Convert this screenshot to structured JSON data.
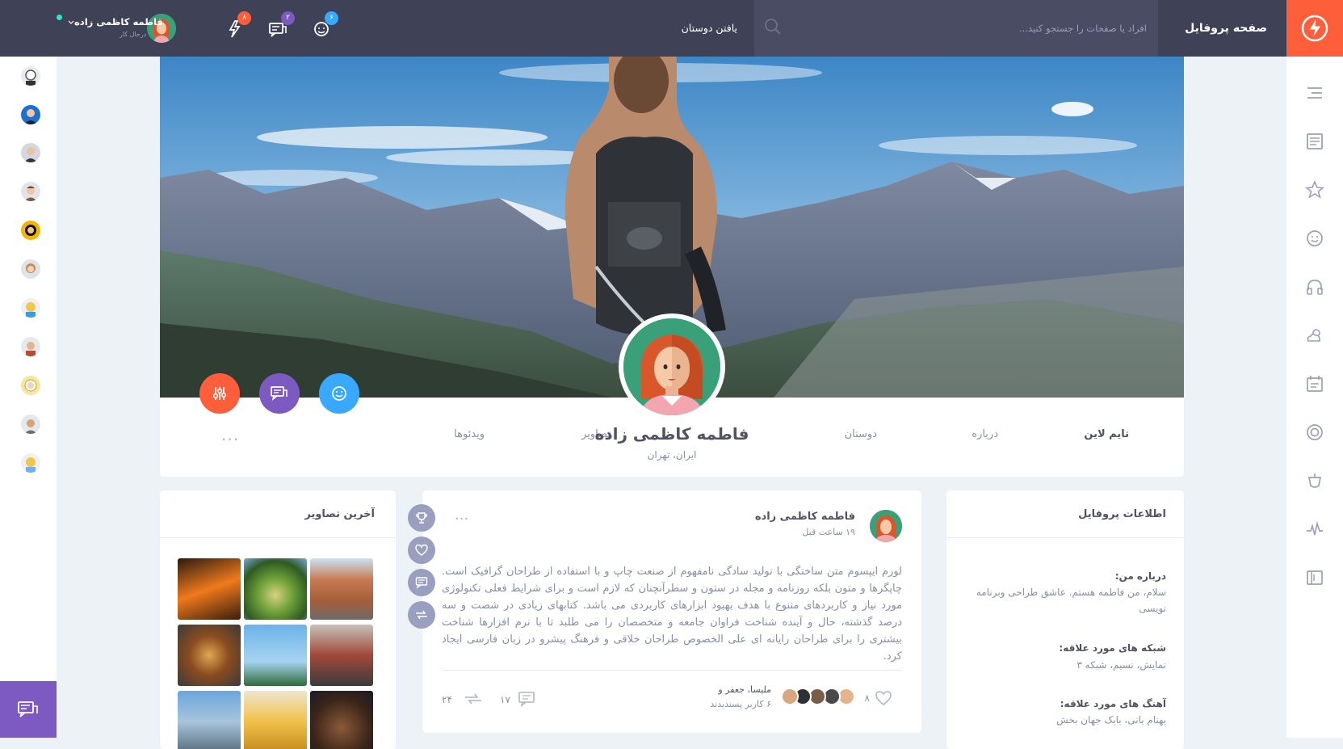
{
  "header": {
    "page_title": "صفحه پروفایل",
    "search_placeholder": "افراد یا صفحات را جستجو کنید...",
    "find_friends": "یافتن دوستان",
    "notifications": [
      {
        "icon": "friend-request-icon",
        "count": "۶",
        "color": "#38a9ff"
      },
      {
        "icon": "messages-icon",
        "count": "۲",
        "color": "#7c5ac2"
      },
      {
        "icon": "activity-icon",
        "count": "۸",
        "color": "#ff5e3a"
      }
    ],
    "user": {
      "name": "فاطمه کاظمی زاده",
      "status": "درحال کار"
    }
  },
  "profile": {
    "name": "فاطمه کاظمی زاده",
    "location": "ایران، تهران",
    "tabs": {
      "timeline": "تایم لاین",
      "about": "درباره",
      "friends": "دوستان",
      "photos": "تصاویر",
      "videos": "ویدئوها",
      "more": "..."
    }
  },
  "profile_info": {
    "title": "اطلاعات پروفایل",
    "about_label": "درباره من:",
    "about_text": "سلام، من فاطمه هستم. عاشق طراحی وبرنامه نویسی",
    "networks_label": "شبکه های مورد علاقه:",
    "networks_text": "نمایش، نسیم، شبکه ۳",
    "music_label": "آهنگ های مورد علاقه:",
    "music_text": "بهنام بانی، بابک جهان بخش"
  },
  "post": {
    "author": "فاطمه کاظمی زاده",
    "time": "۱۹ ساعت قبل",
    "more": "...",
    "text": "لورم ایپسوم متن ساختگی با تولید سادگی نامفهوم از صنعت چاپ و با استفاده از طراحان گرافیک است. چاپگرها و متون بلکه روزنامه و مجله در ستون و سطرآنچنان که لازم است و برای شرایط فعلی تکنولوژی مورد نیاز و کاربردهای متنوع با هدف بهبود ابزارهای کاربردی می باشد. کتابهای زیادی در شصت و سه درصد گذشته، حال و آینده شناخت فراوان جامعه و متخصصان را می طلبد تا با نرم افزارها شناخت بیشتری را برای طراحان رایانه ای علی الخصوص طراحان خلاقی و فرهنگ پیشرو در زبان فارسی ایجاد کرد.",
    "likes": "۸",
    "liked_by": "ملیسا، جعفر و",
    "liked_count_text": "۶ کاربر پسندیدند",
    "comments": "۱۷",
    "shares": "۲۴"
  },
  "photos_widget": {
    "title": "آخرین تصاویر"
  },
  "colors": {
    "topbar": "#3f4257",
    "accent": "#ff5e3a",
    "purple": "#7c5ac2",
    "blue": "#38a9ff"
  }
}
